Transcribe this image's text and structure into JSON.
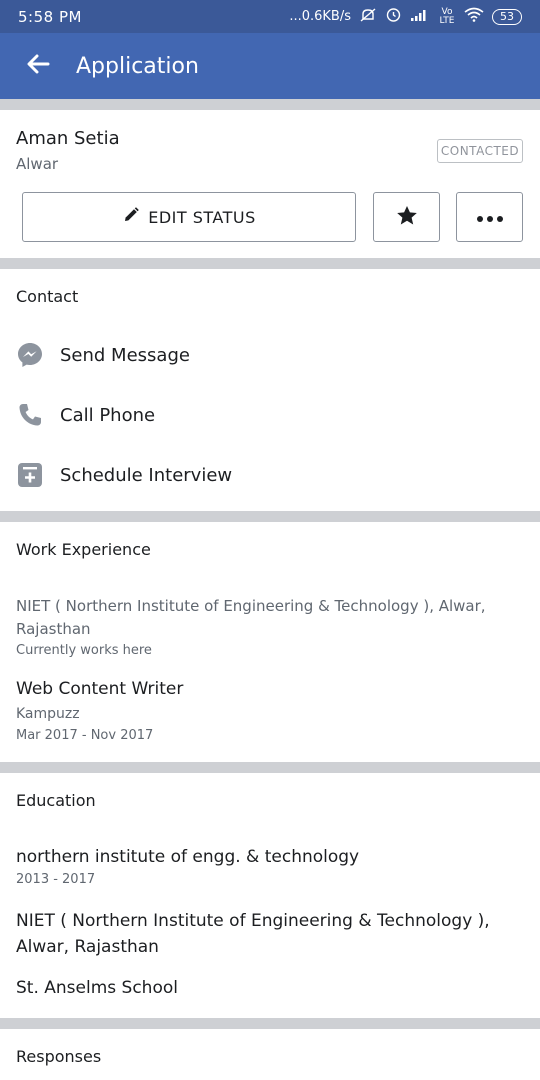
{
  "status_bar": {
    "time": "5:58 PM",
    "network_speed": "...0.6KB/s",
    "network_type": "Vo LTE",
    "battery": "53",
    "icons": [
      "mute-icon",
      "alarm-icon",
      "signal-icon",
      "wifi-icon",
      "battery-icon"
    ]
  },
  "app_bar": {
    "title": "Application",
    "back_icon": "arrow-left-icon"
  },
  "profile": {
    "name": "Aman Setia",
    "location": "Alwar",
    "status_badge": "CONTACTED"
  },
  "actions": {
    "edit_status_label": "EDIT STATUS",
    "edit_icon": "pencil-icon",
    "star_icon": "star-icon",
    "more_icon": "more-icon"
  },
  "contact": {
    "title": "Contact",
    "items": [
      {
        "label": "Send Message",
        "icon": "messenger-icon"
      },
      {
        "label": "Call Phone",
        "icon": "phone-icon"
      },
      {
        "label": "Schedule Interview",
        "icon": "calendar-plus-icon"
      }
    ]
  },
  "work_experience": {
    "title": "Work Experience",
    "items": [
      {
        "org": "NIET ( Northern Institute of Engineering & Technology ), Alwar, Rajasthan",
        "sub": "Currently works here"
      },
      {
        "role": "Web Content Writer",
        "company": "Kampuzz",
        "dates": "Mar 2017 - Nov 2017"
      }
    ]
  },
  "education": {
    "title": "Education",
    "items": [
      {
        "name": "northern institute of engg. & technology",
        "dates": "2013 - 2017"
      },
      {
        "name": "NIET ( Northern Institute of Engineering & Technology ), Alwar, Rajasthan"
      },
      {
        "name": "St. Anselms School"
      }
    ]
  },
  "responses": {
    "title": "Responses"
  },
  "colors": {
    "status_bar": "#3b5998",
    "app_bar": "#4267b2",
    "divider": "#ced0d4",
    "icon_gray": "#8d949e"
  }
}
